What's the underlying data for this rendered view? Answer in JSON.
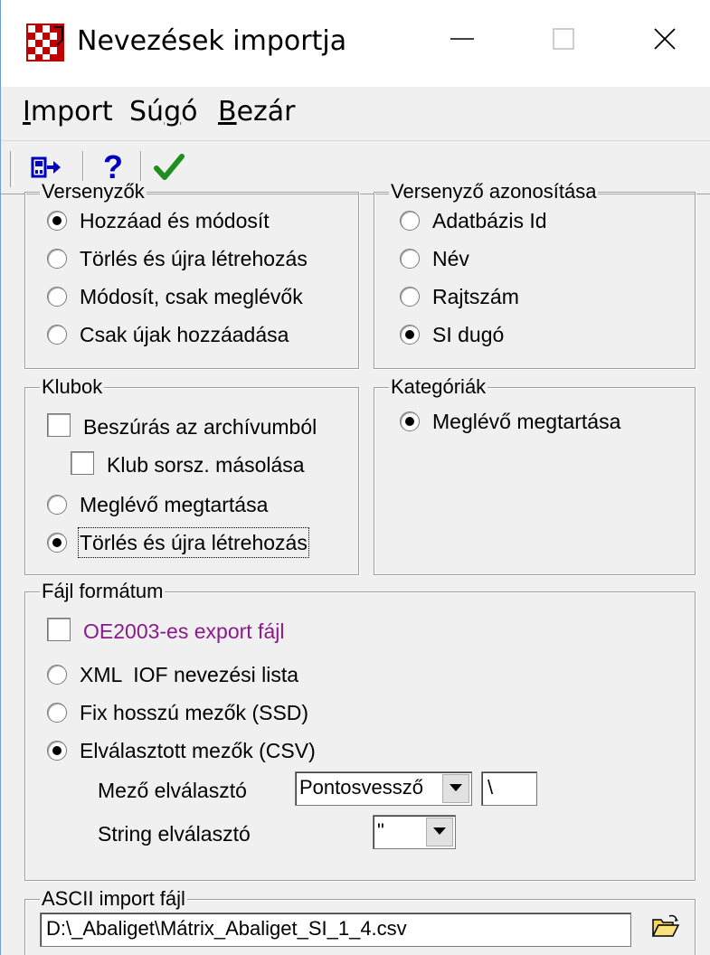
{
  "window": {
    "title": "Nevezések importja",
    "icon": "app-checkered-flag-icon"
  },
  "menu": {
    "items": [
      "Import",
      "Súgó",
      "Bezár"
    ]
  },
  "toolbar": {
    "icons": [
      "import-arrow-icon",
      "help-icon",
      "ok-checkmark-icon"
    ]
  },
  "competitors": {
    "title": "Versenyzők",
    "options": [
      "Hozzáad és módosít",
      "Törlés és újra létrehozás",
      "Módosít, csak meglévők",
      "Csak újak hozzáadása"
    ],
    "selected_index": 0
  },
  "identification": {
    "title": "Versenyző azonosítása",
    "options": [
      "Adatbázis Id",
      "Név",
      "Rajtszám",
      "SI dugó"
    ],
    "selected_index": 3
  },
  "clubs": {
    "title": "Klubok",
    "insert_from_archive": "Beszúrás az archívumból",
    "copy_club_number": "Klub sorsz. másolása",
    "options": [
      "Meglévő megtartása",
      "Törlés és újra létrehozás"
    ],
    "selected_index": 1
  },
  "categories": {
    "title": "Kategóriák",
    "options": [
      "Meglévő megtartása"
    ],
    "selected_index": 0
  },
  "file_format": {
    "title": "Fájl formátum",
    "oe2003_label": "OE2003-es export fájl",
    "options": [
      "XML  IOF nevezési lista",
      "Fix hosszú mezők (SSD)",
      "Elválasztott mezők (CSV)"
    ],
    "selected_index": 2,
    "field_separator_label": "Mező elválasztó",
    "field_separator_value": "Pontosvessző",
    "field_separator_extra": "\\",
    "string_separator_label": "String elválasztó",
    "string_separator_value": "\""
  },
  "ascii_import": {
    "title": "ASCII import fájl",
    "path": "D:\\_Abaliget\\Mátrix_Abaliget_SI_1_4.csv"
  },
  "colors": {
    "oe2003_text": "#8b1a8b",
    "check_green": "#1f8f1f",
    "help_blue": "#0000c0"
  }
}
